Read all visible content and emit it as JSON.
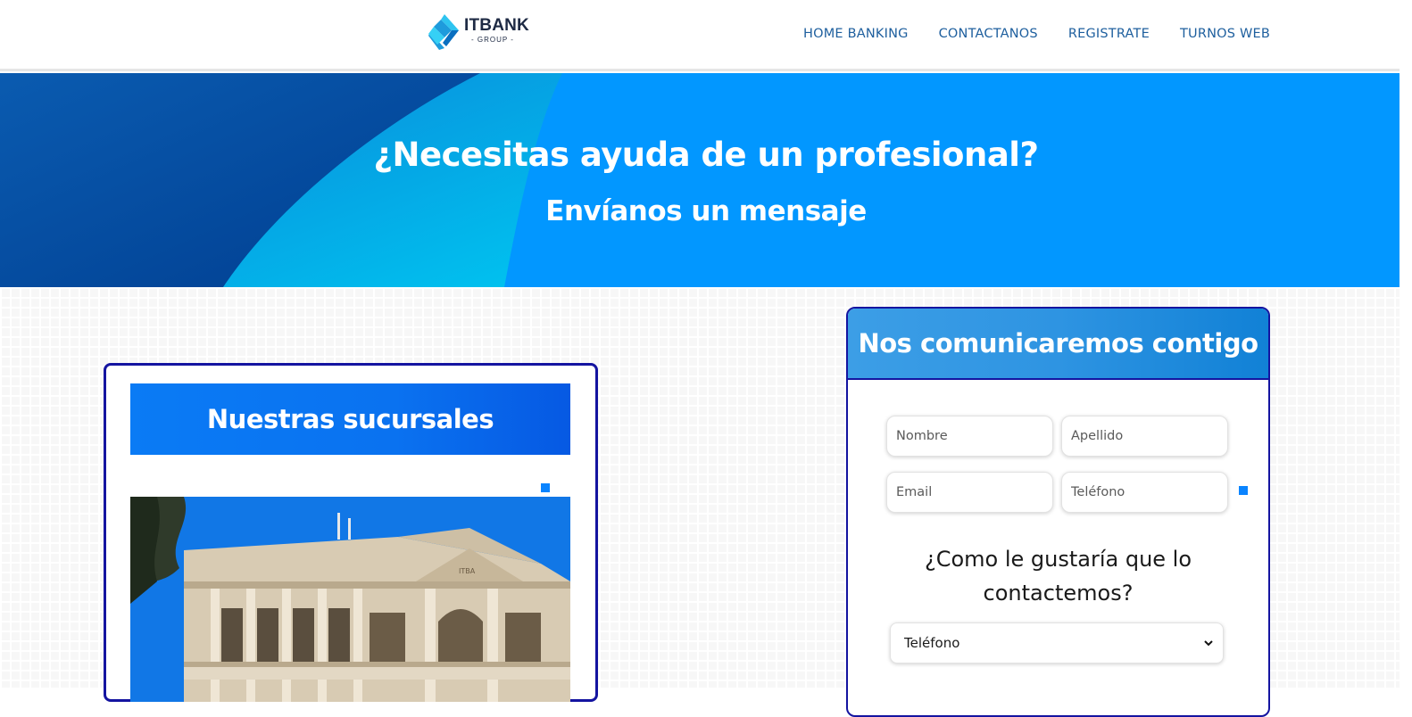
{
  "header": {
    "logo": {
      "name": "ITBANK",
      "sub": "- GROUP -"
    },
    "nav": [
      {
        "label": "HOME BANKING"
      },
      {
        "label": "CONTACTANOS"
      },
      {
        "label": "REGISTRATE"
      },
      {
        "label": "TURNOS WEB"
      }
    ]
  },
  "hero": {
    "title": "¿Necesitas ayuda de un profesional?",
    "subtitle": "Envíanos un mensaje"
  },
  "branches": {
    "title": "Nuestras sucursales",
    "photo_text": "ITBA"
  },
  "contact": {
    "title": "Nos comunicaremos contigo",
    "fields": {
      "nombre_placeholder": "Nombre",
      "apellido_placeholder": "Apellido",
      "email_placeholder": "Email",
      "telefono_placeholder": "Teléfono"
    },
    "question": "¿Como le gustaría que lo contactemos?",
    "contact_method": {
      "selected": "Teléfono"
    }
  },
  "colors": {
    "brand_blue": "#0297ff",
    "nav_text": "#1e5f9e",
    "card_border": "#1414a0"
  },
  "icons": [
    "itbank-logo-icon",
    "chevron-down-icon"
  ]
}
